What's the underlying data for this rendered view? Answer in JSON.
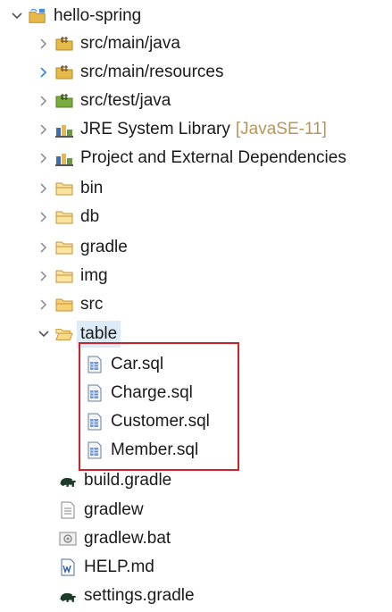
{
  "tree": {
    "root": {
      "label": "hello-spring",
      "expanded": true
    },
    "items": [
      {
        "label": "src/main/java",
        "icon": "source-folder-icon"
      },
      {
        "label": "src/main/resources",
        "icon": "source-folder-icon"
      },
      {
        "label": "src/test/java",
        "icon": "test-source-folder-icon"
      },
      {
        "label": "JRE System Library",
        "decoration": "[JavaSE-11]",
        "icon": "library-icon"
      },
      {
        "label": "Project and External Dependencies",
        "icon": "library-icon"
      },
      {
        "label": "bin",
        "icon": "folder-icon"
      },
      {
        "label": "db",
        "icon": "folder-icon"
      },
      {
        "label": "gradle",
        "icon": "folder-icon"
      },
      {
        "label": "img",
        "icon": "folder-icon"
      },
      {
        "label": "src",
        "icon": "folder-icon"
      },
      {
        "label": "table",
        "icon": "folder-open-icon",
        "expanded": true
      }
    ],
    "table_children": [
      {
        "label": "Car.sql"
      },
      {
        "label": "Charge.sql"
      },
      {
        "label": "Customer.sql"
      },
      {
        "label": "Member.sql"
      }
    ],
    "files": [
      {
        "label": "build.gradle",
        "icon": "gradle-elephant-icon"
      },
      {
        "label": "gradlew",
        "icon": "text-file-icon"
      },
      {
        "label": "gradlew.bat",
        "icon": "bat-file-icon"
      },
      {
        "label": "HELP.md",
        "icon": "markdown-file-icon"
      },
      {
        "label": "settings.gradle",
        "icon": "gradle-elephant-icon"
      }
    ]
  },
  "colors": {
    "highlight_box": "#d0202a",
    "folder": "#e6b94a",
    "decoration": "#b8955a"
  }
}
